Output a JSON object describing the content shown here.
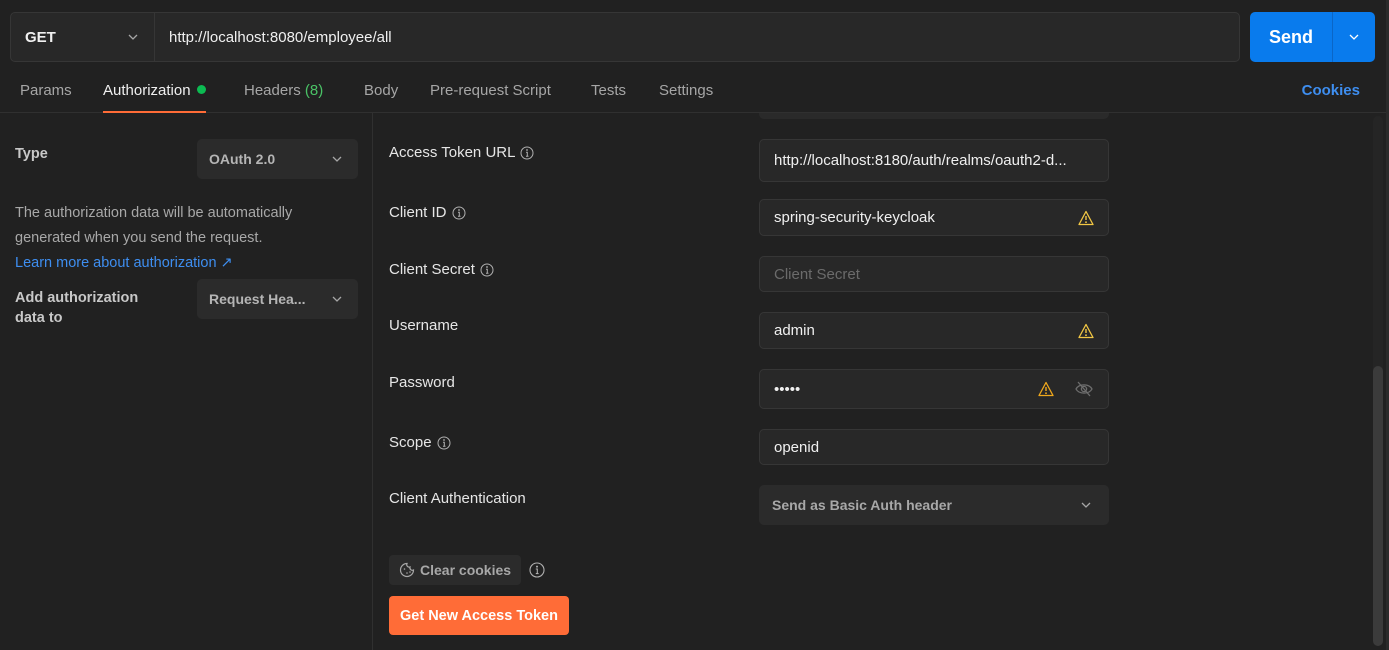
{
  "request": {
    "method": "GET",
    "url": "http://localhost:8080/employee/all",
    "send_label": "Send"
  },
  "tabs": [
    {
      "label": "Params"
    },
    {
      "label": "Authorization",
      "active": true,
      "indicator": "green-dot"
    },
    {
      "label": "Headers",
      "count": "(8)"
    },
    {
      "label": "Body"
    },
    {
      "label": "Pre-request Script"
    },
    {
      "label": "Tests"
    },
    {
      "label": "Settings"
    }
  ],
  "cookies_link": "Cookies",
  "auth": {
    "type_label": "Type",
    "type_value": "OAuth 2.0",
    "description": "The authorization data will be automatically generated when you send the request.",
    "learn_more": "Learn more about authorization ↗",
    "add_to_label_line1": "Add authorization",
    "add_to_label_line2": "data to",
    "add_to_value": "Request Hea..."
  },
  "fields": {
    "access_token_url": {
      "label": "Access Token URL",
      "value": "http://localhost:8180/auth/realms/oauth2-d..."
    },
    "client_id": {
      "label": "Client ID",
      "value": "spring-security-keycloak"
    },
    "client_secret": {
      "label": "Client Secret",
      "placeholder": "Client Secret",
      "value": ""
    },
    "username": {
      "label": "Username",
      "value": "admin"
    },
    "password": {
      "label": "Password",
      "value": "•••••"
    },
    "scope": {
      "label": "Scope",
      "value": "openid"
    },
    "client_authentication": {
      "label": "Client Authentication",
      "value": "Send as Basic Auth header"
    }
  },
  "actions": {
    "clear_cookies": "Clear cookies",
    "get_token": "Get New Access Token"
  },
  "colors": {
    "accent_orange": "#ff6c37",
    "send_blue": "#097bed",
    "link_blue": "#3e8ef0",
    "warning_yellow": "#f2c744",
    "success_green": "#0cbb52"
  }
}
